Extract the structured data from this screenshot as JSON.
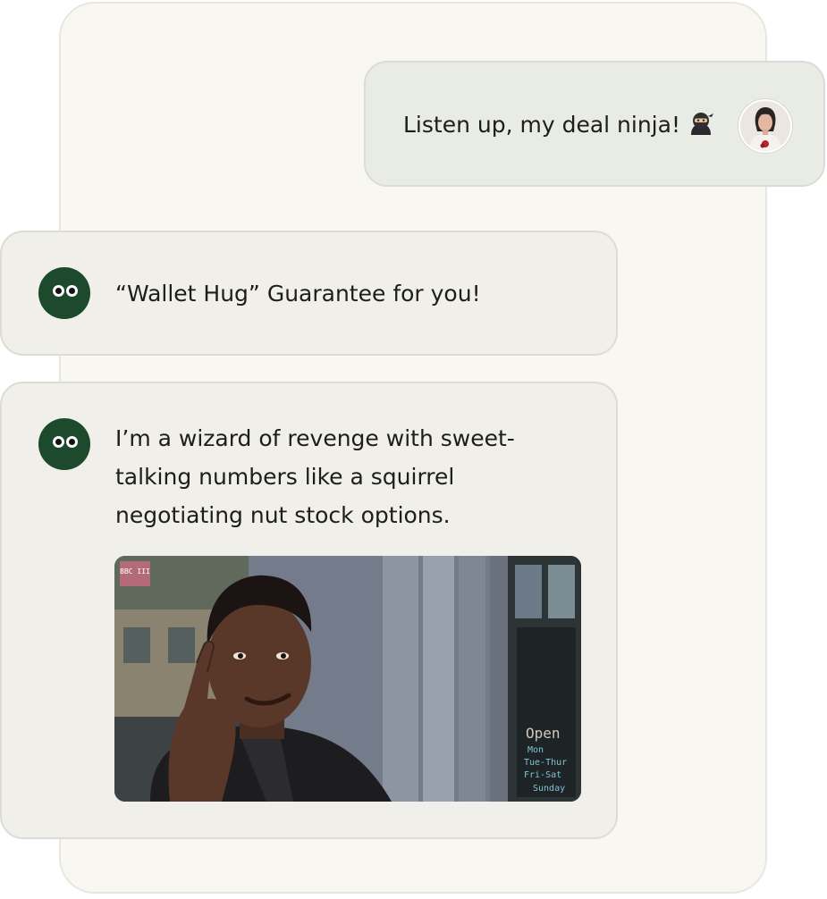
{
  "user_message": {
    "text": "Listen up, my deal ninja!",
    "emoji": "ninja-emoji"
  },
  "bot_messages": [
    {
      "text": "“Wallet Hug” Guarantee for you!"
    },
    {
      "text": "I’m a wizard of revenge with sweet-talking numbers like a squirrel negotiating nut stock options.",
      "image": {
        "channel_badge": "BBC III",
        "sign_lines": [
          "Open",
          "Mon",
          "Tue-Thur",
          "Fri-Sat",
          "Sunday"
        ]
      }
    }
  ],
  "colors": {
    "panel_bg": "#f8f7f2",
    "user_bubble": "#e9ebe5",
    "bot_bubble": "#f0efe9",
    "bot_avatar": "#1d4a2c",
    "text": "#1d1d1b"
  }
}
